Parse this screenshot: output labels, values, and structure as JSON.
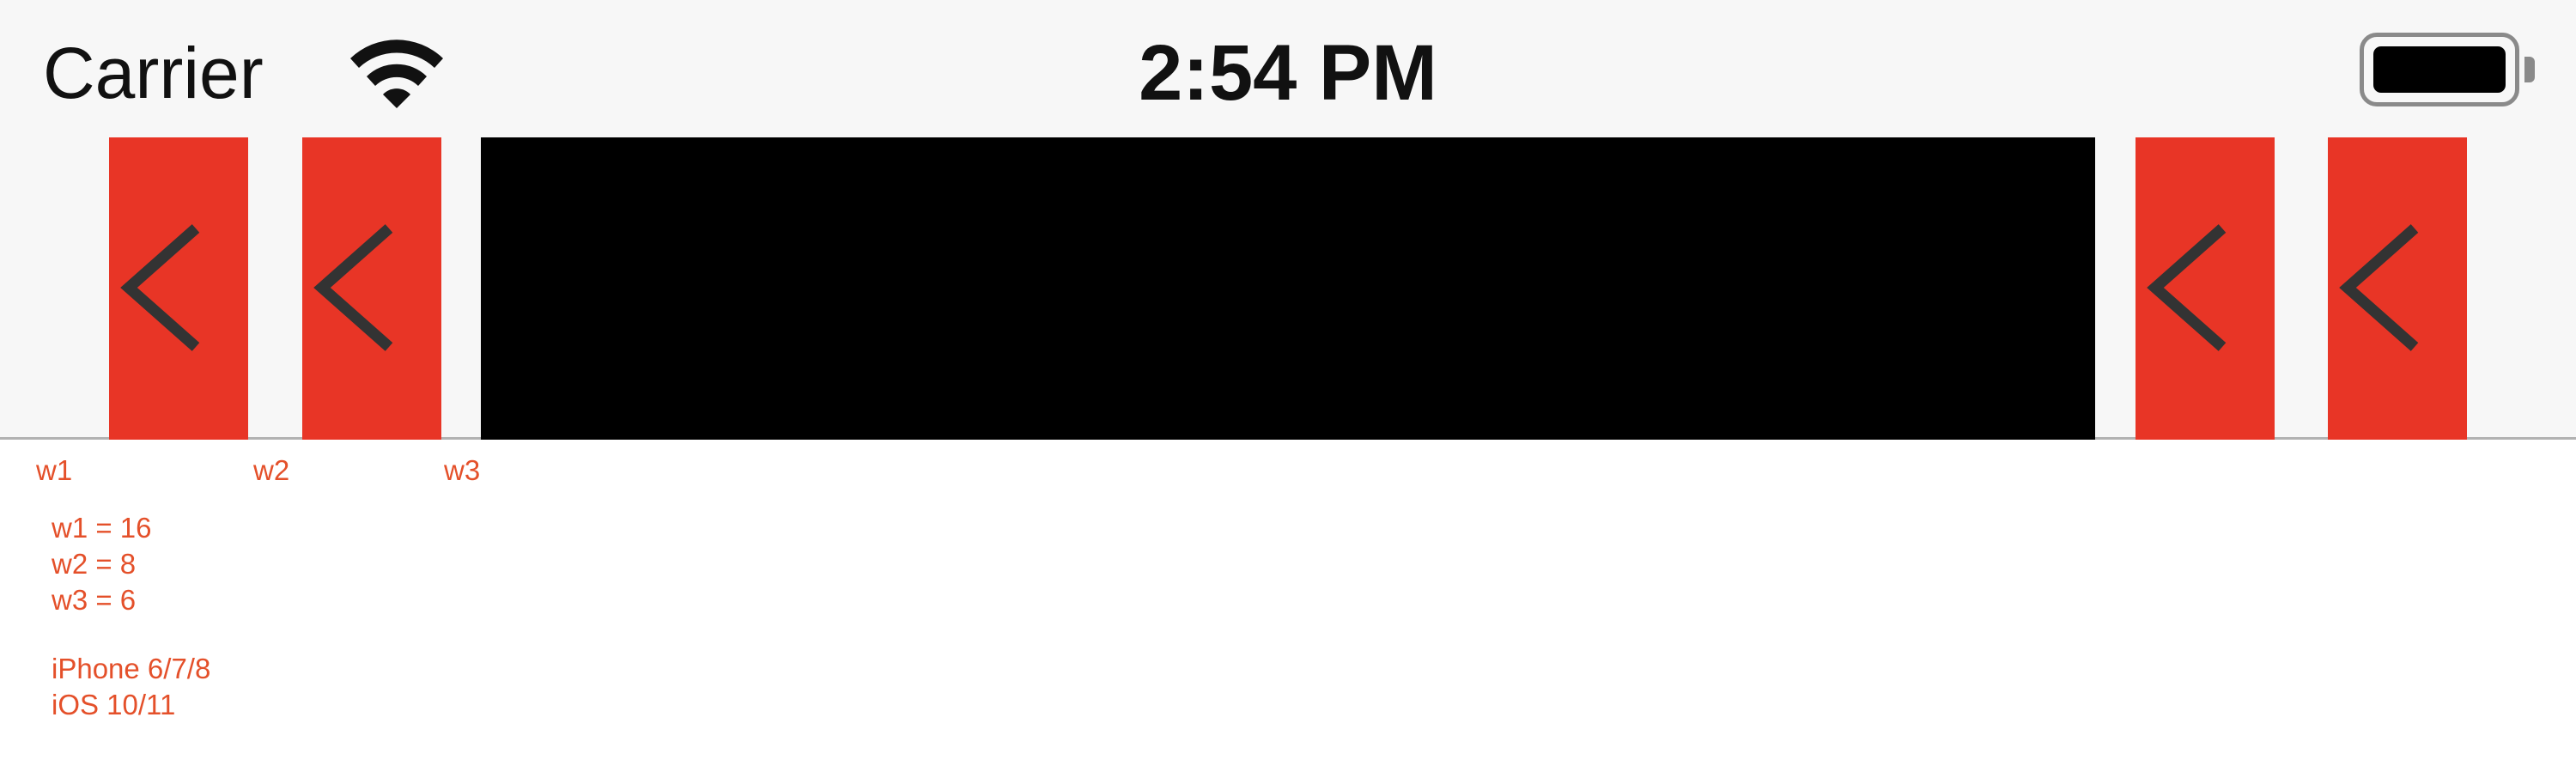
{
  "status_bar": {
    "carrier": "Carrier",
    "time": "2:54 PM",
    "wifi_icon": "wifi-icon",
    "battery_icon": "battery-icon"
  },
  "navigation_bar": {
    "left_buttons": [
      {
        "icon": "chevron-left-icon",
        "color": "#e83526"
      },
      {
        "icon": "chevron-left-icon",
        "color": "#e83526"
      }
    ],
    "title_view": {
      "color": "#000000"
    },
    "right_buttons": [
      {
        "icon": "chevron-left-icon",
        "color": "#e83526"
      },
      {
        "icon": "chevron-left-icon",
        "color": "#e83526"
      }
    ],
    "chevron_color": "#333333"
  },
  "annotations": {
    "labels": [
      "w1",
      "w2",
      "w3"
    ],
    "values": [
      "w1 = 16",
      "w2 = 8",
      "w3 = 6"
    ],
    "device": "iPhone 6/7/8",
    "os": "iOS 10/11",
    "accent_color": "#e4502a"
  }
}
